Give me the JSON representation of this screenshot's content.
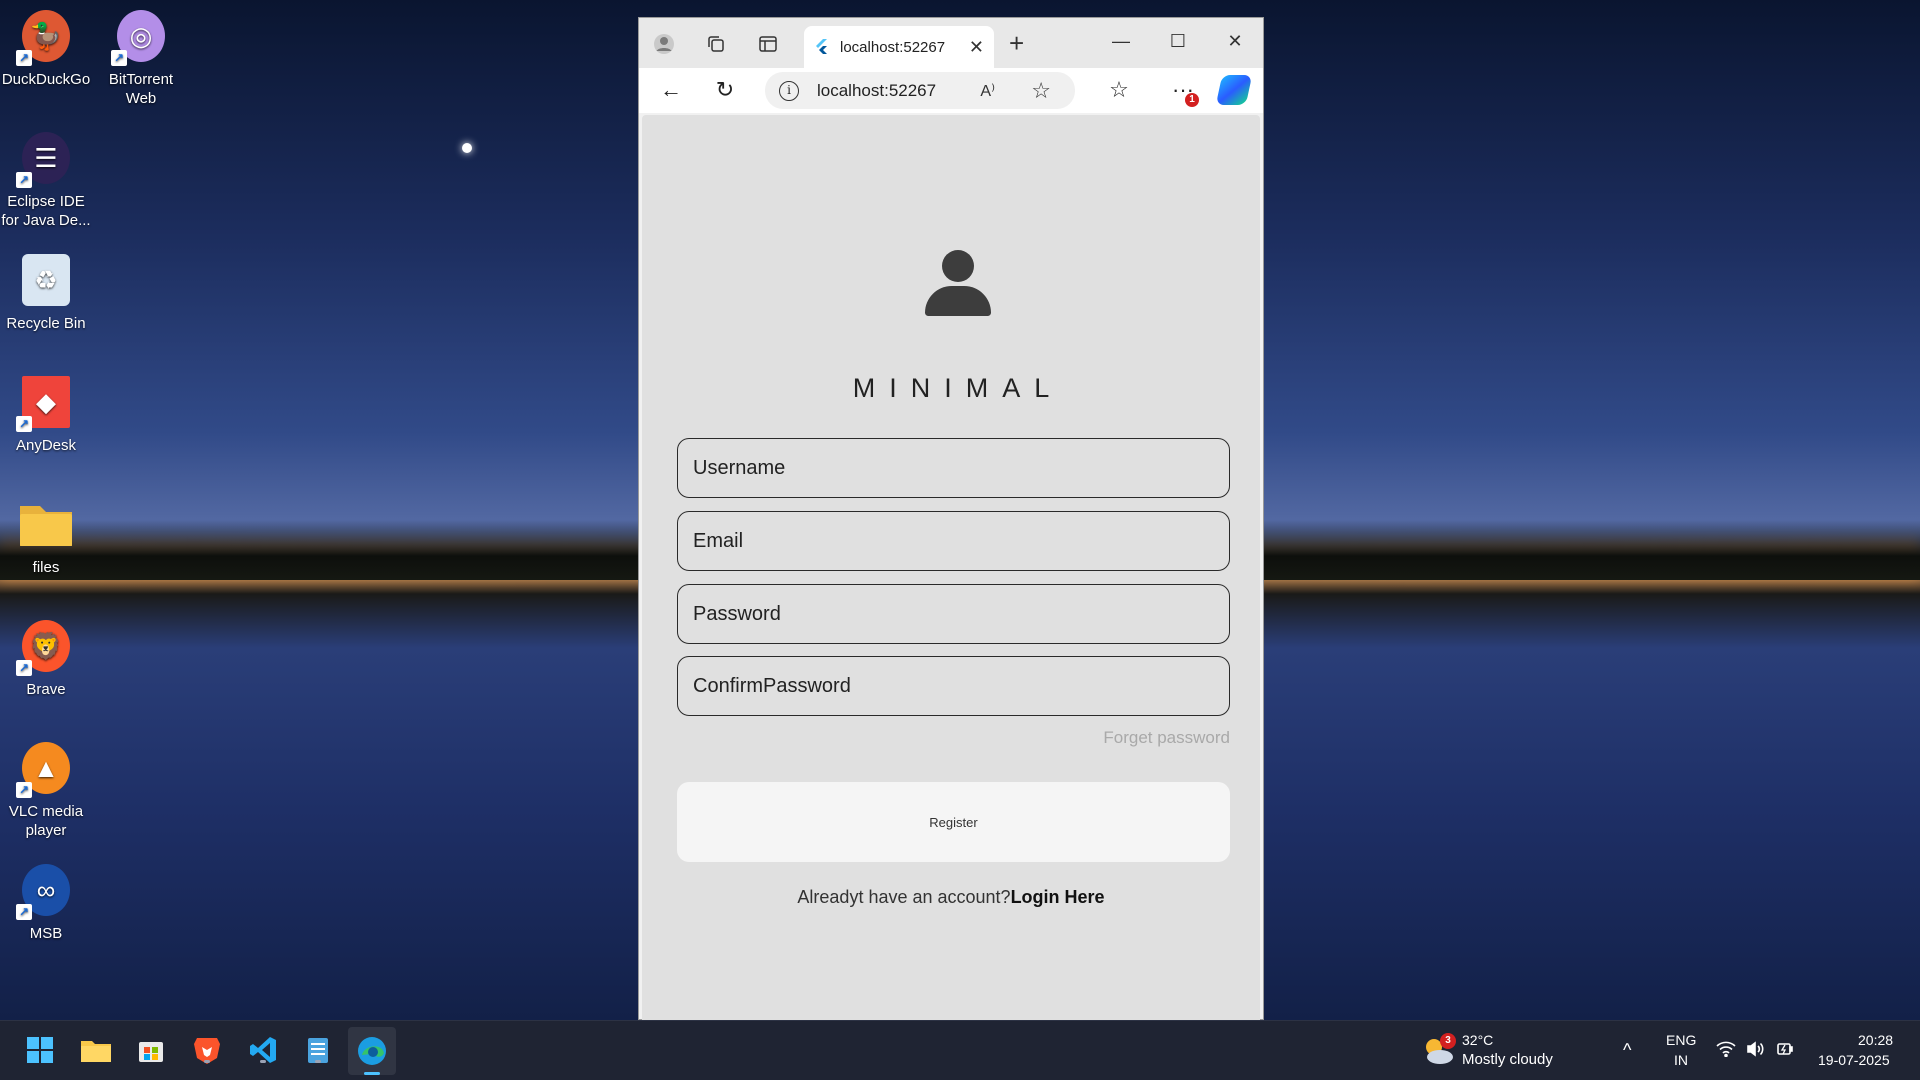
{
  "desktop": {
    "icons": [
      {
        "label": "DuckDuckGo",
        "glyph": "🦆",
        "color": "#de5833"
      },
      {
        "label": "BitTorrent Web",
        "glyph": "◎",
        "color": "#b38ee8"
      },
      {
        "label": "Eclipse IDE for Java De...",
        "glyph": "☰",
        "color": "#2c2255"
      },
      {
        "label": "Recycle Bin",
        "glyph": "♻",
        "color": "#d9e6f2"
      },
      {
        "label": "AnyDesk",
        "glyph": "◆",
        "color": "#ef443b"
      },
      {
        "label": "files",
        "glyph": "",
        "color": "#f8c84a"
      },
      {
        "label": "Brave",
        "glyph": "🦁",
        "color": "#fb542b"
      },
      {
        "label": "VLC media player",
        "glyph": "▲",
        "color": "#f58a1f"
      },
      {
        "label": "MSB",
        "glyph": "∞",
        "color": "#1a4fa8"
      }
    ]
  },
  "browser": {
    "tab_title": "localhost:52267",
    "address": "localhost:52267",
    "read_aloud_label": "A⁾",
    "notification_count": "1"
  },
  "app": {
    "title": "MINIMAL",
    "fields": {
      "username": "Username",
      "email": "Email",
      "password": "Password",
      "confirm_password": "ConfirmPassword"
    },
    "forget_password": "Forget password",
    "register_label": "Register",
    "login_prompt": "Alreadyt have an account?",
    "login_link": "Login Here"
  },
  "taskbar": {
    "weather_badge": "3",
    "temperature": "32°C",
    "weather_desc": "Mostly cloudy",
    "lang_top": "ENG",
    "lang_bottom": "IN",
    "time": "20:28",
    "date": "19-07-2025"
  }
}
